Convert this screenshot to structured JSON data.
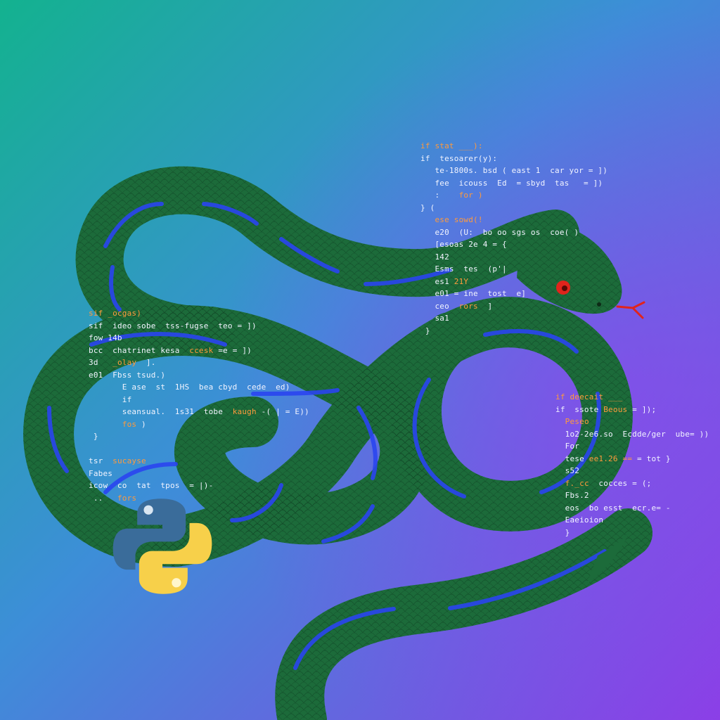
{
  "scene": {
    "background_gradient": [
      "#13b28f",
      "#3d8ed8",
      "#8a3fe6"
    ],
    "snake_color": "#1c6b3a",
    "snake_stripe_color": "#2a45f0",
    "eye_color": "#e0241c",
    "tongue_color": "#e0241c"
  },
  "logo": {
    "icon": "python-logo-icon",
    "blue": "#3a6c9a",
    "yellow": "#f7d04a"
  },
  "code_snippets": [
    {
      "lines": [
        [
          {
            "t": "if ",
            "k": "kw"
          },
          {
            "t": "stat ___):",
            "k": "kw"
          }
        ],
        [
          {
            "t": "if  tesoarer(y):",
            "k": "tx"
          }
        ],
        [
          {
            "t": "   te-1800s. bsd ( east 1  car yor = ])",
            "k": "tx"
          }
        ],
        [
          {
            "t": "   fee  icouss  Ed  = sbyd  tas   = ])",
            "k": "tx"
          }
        ],
        [
          {
            "t": "   :    ",
            "k": "tx"
          },
          {
            "t": "for )",
            "k": "kw"
          }
        ],
        [
          {
            "t": "} (",
            "k": "tx"
          }
        ],
        [
          {
            "t": "   ",
            "k": "tx"
          },
          {
            "t": "ese sowd(!",
            "k": "kw"
          }
        ],
        [
          {
            "t": "   e20  (U:  bo oo sgs os  coe( )",
            "k": "tx"
          }
        ],
        [
          {
            "t": "   [esoas 2e 4 = {",
            "k": "tx"
          }
        ],
        [
          {
            "t": "   142",
            "k": "tx"
          }
        ],
        [
          {
            "t": "   Esms  tes  (p'|",
            "k": "tx"
          }
        ],
        [
          {
            "t": "   es1 ",
            "k": "tx"
          },
          {
            "t": "21Y",
            "k": "kw"
          }
        ],
        [
          {
            "t": "   e01 = ine  tost  e]",
            "k": "tx"
          }
        ],
        [
          {
            "t": "   ceo  ",
            "k": "tx"
          },
          {
            "t": "rors",
            "k": "kw"
          },
          {
            "t": "  ]",
            "k": "tx"
          }
        ],
        [
          {
            "t": "   sa1",
            "k": "tx"
          }
        ],
        [
          {
            "t": " }",
            "k": "tx"
          }
        ]
      ]
    },
    {
      "lines": [
        [
          {
            "t": "sif ",
            "k": "kw"
          },
          {
            "t": "_ocgas)",
            "k": "kw"
          }
        ],
        [
          {
            "t": "sif  ",
            "k": "tx"
          },
          {
            "t": "ideo sobe  tss-fugse  teo = ])",
            "k": "tx"
          }
        ],
        [
          {
            "t": "fow 14b",
            "k": "tx"
          }
        ],
        [
          {
            "t": "bcc  chatrinet kesa  ",
            "k": "tx"
          },
          {
            "t": "ccesk",
            "k": "kw"
          },
          {
            "t": " =e = ])",
            "k": "tx"
          }
        ],
        [
          {
            "t": "3d   ",
            "k": "tx"
          },
          {
            "t": "_olay",
            "k": "kw"
          },
          {
            "t": "  ].",
            "k": "tx"
          }
        ],
        [
          {
            "t": "e01  Fbss tsud.)",
            "k": "tx"
          }
        ],
        [
          {
            "t": "       E ase  st  1HS  bea cbyd  cede  ed)",
            "k": "tx"
          }
        ],
        [
          {
            "t": "       if",
            "k": "tx"
          }
        ],
        [
          {
            "t": "       seansual.  1s31  tobe  ",
            "k": "tx"
          },
          {
            "t": "kaugh",
            "k": "kw"
          },
          {
            "t": " -( | = E))",
            "k": "tx"
          }
        ],
        [
          {
            "t": "       ",
            "k": "tx"
          },
          {
            "t": "fos",
            "k": "kw"
          },
          {
            "t": " )",
            "k": "tx"
          }
        ],
        [
          {
            "t": " }",
            "k": "tx"
          }
        ],
        [
          {
            "t": "",
            "k": "tx"
          }
        ],
        [
          {
            "t": "tsr  ",
            "k": "tx"
          },
          {
            "t": "sucayse",
            "k": "kw"
          }
        ],
        [
          {
            "t": "Fabes",
            "k": "tx"
          }
        ],
        [
          {
            "t": "icow  co  tat  tpos  = |)-",
            "k": "tx"
          }
        ],
        [
          {
            "t": " ..   ",
            "k": "tx"
          },
          {
            "t": "fors",
            "k": "kw"
          }
        ]
      ]
    },
    {
      "lines": [
        [
          {
            "t": "if ",
            "k": "kw"
          },
          {
            "t": "deecait ___",
            "k": "kw"
          }
        ],
        [
          {
            "t": "if  ssote ",
            "k": "tx"
          },
          {
            "t": "Beous",
            "k": "kw"
          },
          {
            "t": " = ]);",
            "k": "tx"
          }
        ],
        [
          {
            "t": "  ",
            "k": "tx"
          },
          {
            "t": "Peseo",
            "k": "kw"
          }
        ],
        [
          {
            "t": "  1o2-2e6.so  Ecdde/ger  ube= ))",
            "k": "tx"
          }
        ],
        [
          {
            "t": "  For",
            "k": "tx"
          }
        ],
        [
          {
            "t": "  tese ",
            "k": "tx"
          },
          {
            "t": "ee1.26 ==",
            "k": "kw"
          },
          {
            "t": " = tot }",
            "k": "tx"
          }
        ],
        [
          {
            "t": "  s52",
            "k": "tx"
          }
        ],
        [
          {
            "t": "  ",
            "k": "tx"
          },
          {
            "t": "f._cc",
            "k": "kw"
          },
          {
            "t": "  cocces = (;",
            "k": "tx"
          }
        ],
        [
          {
            "t": "  Fbs.2",
            "k": "tx"
          }
        ],
        [
          {
            "t": "  eos  bo esst  ecr.e= -",
            "k": "tx"
          }
        ],
        [
          {
            "t": "  Eaeioion",
            "k": "tx"
          }
        ],
        [
          {
            "t": "  }",
            "k": "tx"
          }
        ]
      ]
    }
  ]
}
